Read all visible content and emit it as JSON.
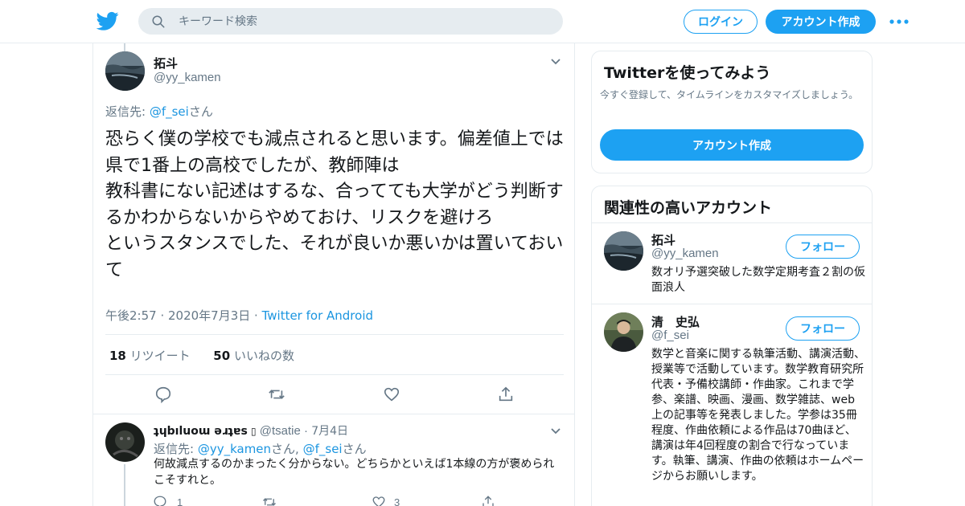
{
  "header": {
    "search_placeholder": "キーワード検索",
    "login_label": "ログイン",
    "signup_label": "アカウント作成",
    "brand_color": "#1da1f2"
  },
  "tweet": {
    "name": "拓斗",
    "handle": "@yy_kamen",
    "reply_prefix": "返信先: ",
    "reply_user": "@f_sei",
    "reply_suffix": "さん",
    "text": "恐らく僕の学校でも減点されると思います。偏差値上では県で1番上の高校でしたが、教師陣は\n教科書にない記述はするな、合ってても大学がどう判断するかわからないからやめておけ、リスクを避けろ\nというスタンスでした、それが良いか悪いかは置いておいて",
    "time": "午後2:57",
    "date": "2020年7月3日",
    "source": "Twitter for Android",
    "retweets": "18",
    "retweets_label": "リツイート",
    "likes": "50",
    "likes_label": "いいねの数"
  },
  "reply": {
    "name": "ʇɥbıluoɯ əɹʇɐs",
    "name_icon": "▯",
    "handle": "@tsatie",
    "date": "7月4日",
    "reply_prefix": "返信先: ",
    "reply_user1": "@yy_kamen",
    "reply_mid": "さん, ",
    "reply_user2": "@f_sei",
    "reply_suffix": "さん",
    "text": "何故減点するのかまったく分からない。どちらかといえば1本線の方が褒められこそすれと。",
    "replies": "1",
    "likes": "3"
  },
  "sidebar": {
    "signup_card": {
      "title": "Twitterを使ってみよう",
      "subtitle": "今すぐ登録して、タイムラインをカスタマイズしましょう。",
      "button": "アカウント作成"
    },
    "related": {
      "title": "関連性の高いアカウント",
      "follow_label": "フォロー",
      "accounts": [
        {
          "name": "拓斗",
          "handle": "@yy_kamen",
          "bio": "数オリ予選突破した数学定期考査２割の仮面浪人"
        },
        {
          "name": "清　史弘",
          "handle": "@f_sei",
          "bio": "数学と音楽に関する執筆活動、講演活動、授業等で活動しています。数学教育研究所代表・予備校講師・作曲家。これまで学参、楽譜、映画、漫画、数学雑誌、web上の記事等を発表しました。学参は35冊程度、作曲依頼による作品は70曲ほど、講演は年4回程度の割合で行なっています。執筆、講演、作曲の依頼はホームページからお願いします。"
        }
      ]
    }
  }
}
